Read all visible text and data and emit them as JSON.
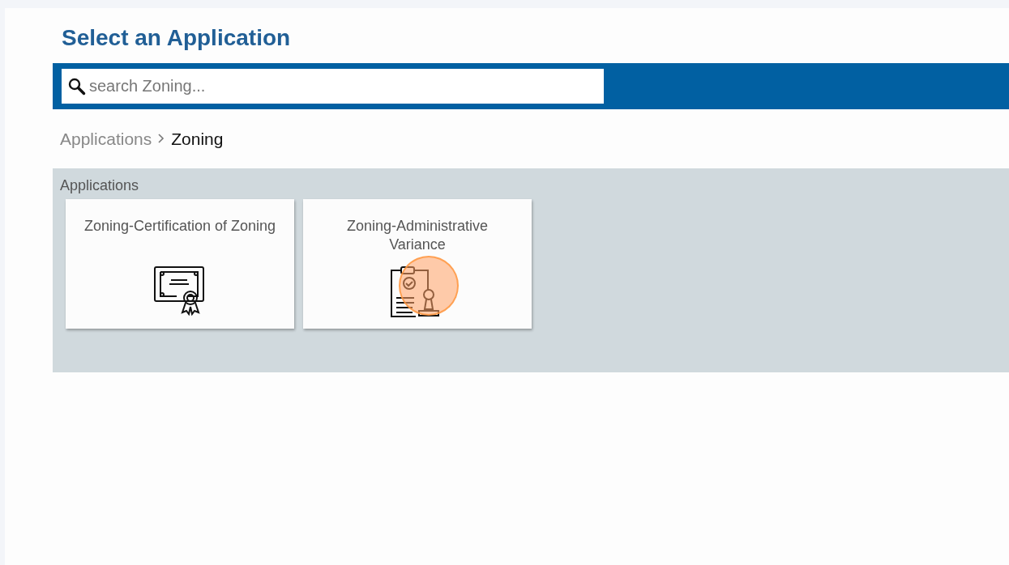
{
  "title": "Select an Application",
  "search": {
    "placeholder": "search Zoning..."
  },
  "breadcrumb": [
    {
      "label": "Applications",
      "current": false
    },
    {
      "label": "Zoning",
      "current": true
    }
  ],
  "section": {
    "heading": "Applications",
    "cards": [
      {
        "label": "Zoning-Certification of Zoning",
        "kind": "certificate",
        "highlighted": false
      },
      {
        "label": "Zoning-Administrative Variance",
        "kind": "stamp",
        "highlighted": true
      }
    ]
  }
}
